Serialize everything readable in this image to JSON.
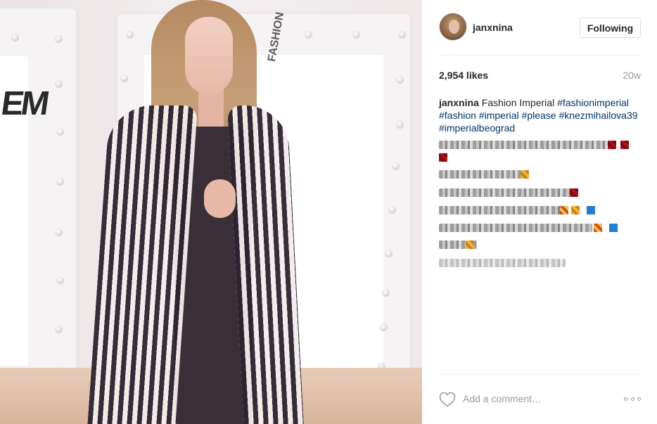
{
  "post": {
    "username": "janxnina",
    "follow_button": "Following",
    "likes": "2,954 likes",
    "time_ago": "20w",
    "caption": {
      "username": "janxnina",
      "text": "Fashion Imperial",
      "hashtags": [
        "#fashionimperial",
        "#fashion",
        "#imperial",
        "#please",
        "#knezmihailova39",
        "#imperialbeograd"
      ]
    },
    "comment_placeholder": "Add a comment…"
  },
  "photo": {
    "wall_logo_left": "EM",
    "wall_logo_right": "FASHION"
  },
  "colors": {
    "hashtag": "#003569",
    "muted": "#999999",
    "text": "#262626",
    "border": "#dbdbdb"
  },
  "icons": {
    "like": "heart-icon",
    "options": "more-options-icon"
  }
}
